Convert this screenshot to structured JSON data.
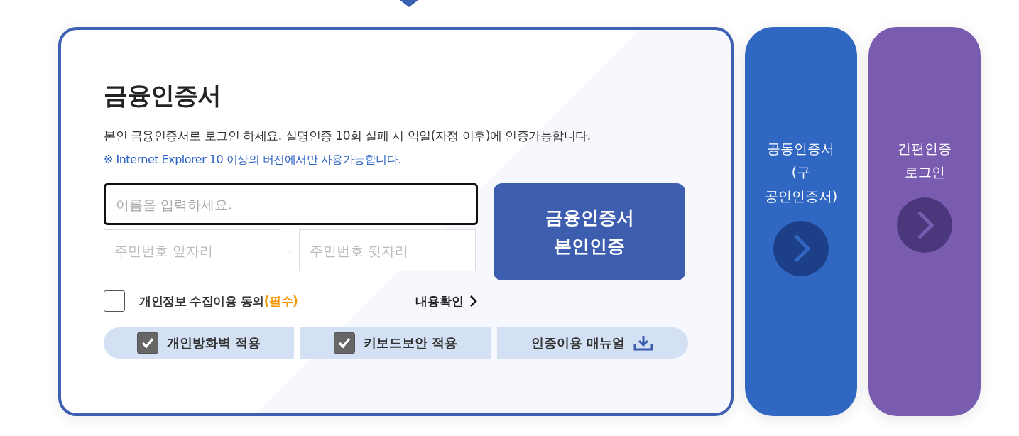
{
  "login_panel": {
    "title": "금융인증서",
    "description": "본인 금융인증서로 로그인 하세요. 실명인증 10회 실패 시 익일(자정 이후)에 인증가능합니다.",
    "notice": "※ Internet Explorer 10 이상의 버전에서만 사용가능합니다.",
    "name_field": {
      "placeholder": "이름을 입력하세요.",
      "focused": true
    },
    "id_front_field": {
      "placeholder": "주민번호 앞자리"
    },
    "separator": "-",
    "id_back_field": {
      "placeholder": "주민번호 뒷자리"
    },
    "submit_button": {
      "lines": [
        "금융인증서",
        "본인인증"
      ]
    },
    "consent": {
      "label": "개인정보 수집이용 동의**(필수)**",
      "checked": false,
      "link": "내용확인"
    },
    "options": [
      {
        "kind": "checkbox",
        "label": "개인방화벽 적용",
        "checked": true
      },
      {
        "kind": "checkbox",
        "label": "키보드보안 적용",
        "checked": true
      },
      {
        "kind": "download",
        "label": "인증이용 매뉴얼"
      }
    ]
  },
  "side_tabs": [
    {
      "lines": [
        "공동인증서",
        "(구",
        "공인인증서)"
      ],
      "color": "#2f67c2"
    },
    {
      "lines": [
        "간편인증",
        "로그인"
      ],
      "color": "#795bb0"
    }
  ]
}
